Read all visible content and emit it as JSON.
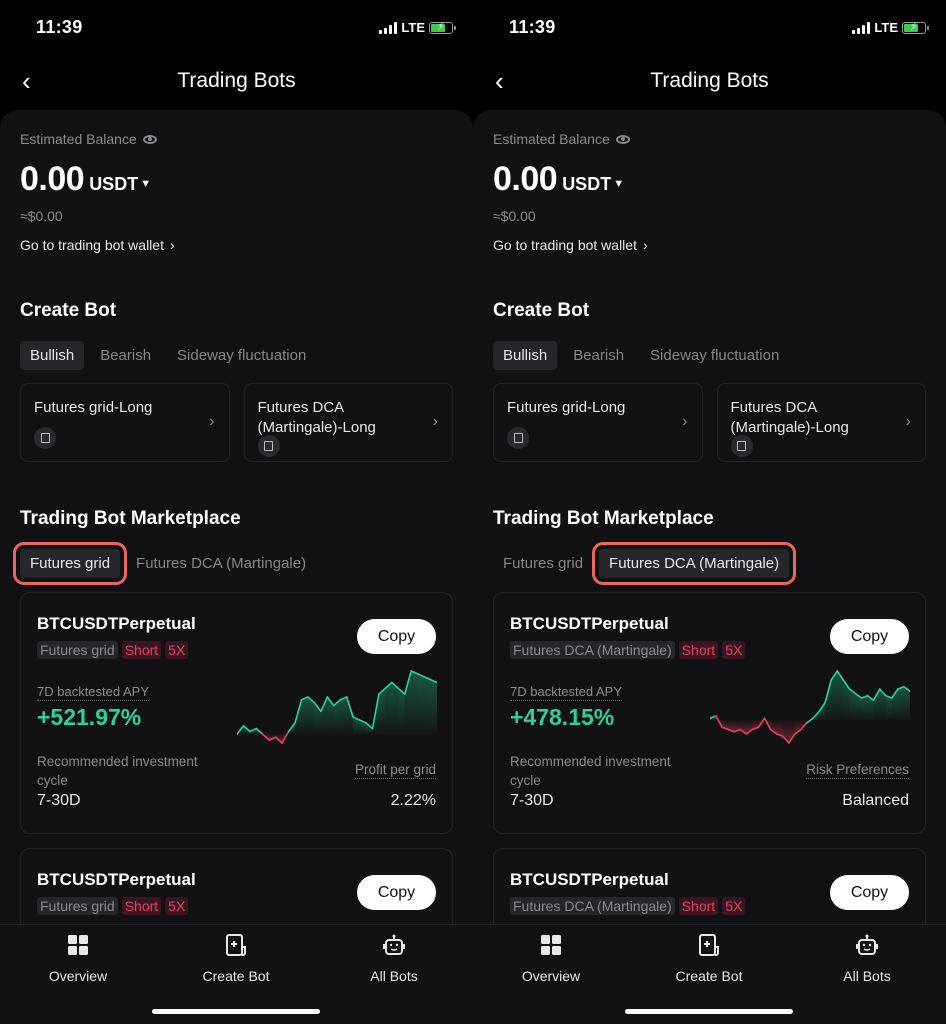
{
  "screens": [
    {
      "status": {
        "time": "11:39",
        "network": "LTE"
      },
      "nav": {
        "back_icon": "chevron-left-icon",
        "title": "Trading Bots"
      },
      "balance": {
        "label": "Estimated Balance",
        "amount": "0.00",
        "unit": "USDT",
        "approx": "≈$0.00",
        "wallet_link": "Go to trading bot wallet"
      },
      "create_bot": {
        "title": "Create Bot",
        "tabs": [
          {
            "label": "Bullish",
            "active": true
          },
          {
            "label": "Bearish",
            "active": false
          },
          {
            "label": "Sideway fluctuation",
            "active": false
          }
        ],
        "cards": [
          {
            "label": "Futures grid-Long",
            "icon": "grid-bot-icon"
          },
          {
            "label": "Futures DCA (Martingale)-Long",
            "icon": "dca-bot-icon"
          }
        ]
      },
      "marketplace": {
        "title": "Trading Bot Marketplace",
        "tabs": [
          {
            "label": "Futures grid",
            "active": true,
            "highlighted": true
          },
          {
            "label": "Futures DCA (Martingale)",
            "active": false,
            "highlighted": false
          }
        ],
        "cards": [
          {
            "pair": "BTCUSDTPerpetual",
            "tags": [
              "Futures grid",
              "Short",
              "5X"
            ],
            "copy_label": "Copy",
            "apy_label": "7D backtested APY",
            "apy_value": "+521.97%",
            "rec_label": "Recommended investment cycle",
            "rec_value": "7-30D",
            "right_label": "Profit per grid",
            "right_value": "2.22%"
          },
          {
            "pair": "BTCUSDTPerpetual",
            "tags": [
              "Futures grid",
              "Short",
              "5X"
            ],
            "copy_label": "Copy"
          }
        ]
      },
      "tabbar": [
        {
          "label": "Overview",
          "icon": "overview-icon"
        },
        {
          "label": "Create Bot",
          "icon": "create-bot-icon"
        },
        {
          "label": "All Bots",
          "icon": "robot-icon"
        }
      ]
    },
    {
      "status": {
        "time": "11:39",
        "network": "LTE"
      },
      "nav": {
        "back_icon": "chevron-left-icon",
        "title": "Trading Bots"
      },
      "balance": {
        "label": "Estimated Balance",
        "amount": "0.00",
        "unit": "USDT",
        "approx": "≈$0.00",
        "wallet_link": "Go to trading bot wallet"
      },
      "create_bot": {
        "title": "Create Bot",
        "tabs": [
          {
            "label": "Bullish",
            "active": true
          },
          {
            "label": "Bearish",
            "active": false
          },
          {
            "label": "Sideway fluctuation",
            "active": false
          }
        ],
        "cards": [
          {
            "label": "Futures grid-Long",
            "icon": "grid-bot-icon"
          },
          {
            "label": "Futures DCA (Martingale)-Long",
            "icon": "dca-bot-icon"
          }
        ]
      },
      "marketplace": {
        "title": "Trading Bot Marketplace",
        "tabs": [
          {
            "label": "Futures grid",
            "active": false,
            "highlighted": false
          },
          {
            "label": "Futures DCA (Martingale)",
            "active": true,
            "highlighted": true
          }
        ],
        "cards": [
          {
            "pair": "BTCUSDTPerpetual",
            "tags": [
              "Futures DCA (Martingale)",
              "Short",
              "5X"
            ],
            "copy_label": "Copy",
            "apy_label": "7D backtested APY",
            "apy_value": "+478.15%",
            "rec_label": "Recommended investment cycle",
            "rec_value": "7-30D",
            "right_label": "Risk Preferences",
            "right_value": "Balanced"
          },
          {
            "pair": "BTCUSDTPerpetual",
            "tags": [
              "Futures DCA (Martingale)",
              "Short",
              "5X"
            ],
            "copy_label": "Copy"
          }
        ]
      },
      "tabbar": [
        {
          "label": "Overview",
          "icon": "overview-icon"
        },
        {
          "label": "Create Bot",
          "icon": "create-bot-icon"
        },
        {
          "label": "All Bots",
          "icon": "robot-icon"
        }
      ]
    }
  ],
  "sparklines": [
    {
      "baseline": 0,
      "values": [
        0,
        3,
        1,
        2,
        0,
        -2,
        -1,
        -3,
        1,
        4,
        12,
        13,
        11,
        8,
        13,
        10,
        12,
        13,
        6,
        5,
        4,
        2,
        14,
        16,
        18,
        16,
        14,
        22,
        21,
        20,
        19,
        18
      ]
    },
    {
      "baseline": 0,
      "values": [
        1,
        2,
        -3,
        -4,
        -5,
        -4,
        -6,
        -4,
        -3,
        1,
        -4,
        -6,
        -7,
        -10,
        -6,
        -4,
        -1,
        1,
        4,
        8,
        18,
        22,
        18,
        14,
        12,
        10,
        11,
        9,
        14,
        11,
        10,
        14,
        15,
        13
      ]
    }
  ],
  "colors": {
    "positive": "#2bd29a",
    "negative": "#e8415e",
    "highlight": "#e8675f"
  }
}
